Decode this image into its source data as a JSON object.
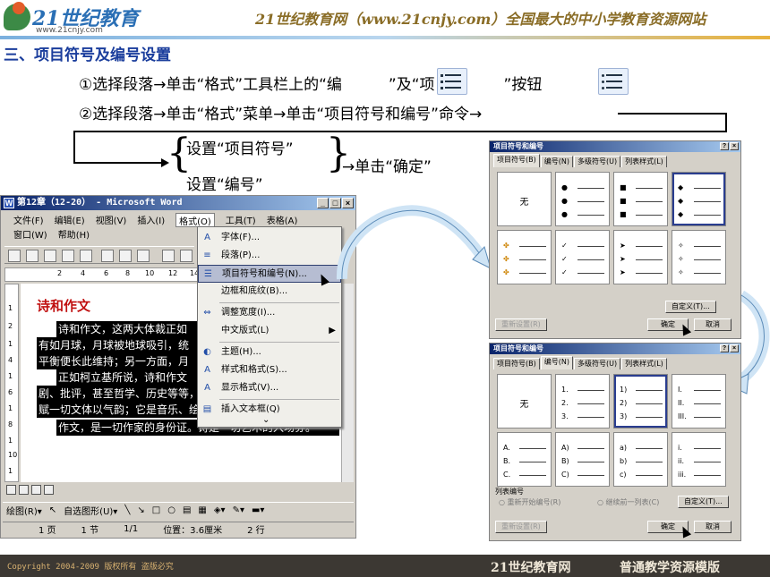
{
  "header": {
    "logo_text": "21世纪教育",
    "logo_url": "www.21cnjy.com",
    "slogan": "21世纪教育网（www.21cnjy.com）全国最大的中小学教育资源网站"
  },
  "section_title": "三、项目符号及编号设置",
  "step1": {
    "a": "①选择段落→单击“格式”工具栏上的“编",
    "b": "”及“项目",
    "c": "”按钮"
  },
  "step2": "②选择段落→单击“格式”菜单→单击“项目符号和编号”命令→",
  "options": {
    "bullet": "设置“项目符号”",
    "number": "设置“编号”",
    "confirm": "→单击“确定”"
  },
  "word": {
    "title": "第12章（12-20） - Microsoft Word",
    "menus": [
      "文件(F)",
      "编辑(E)",
      "视图(V)",
      "插入(I)",
      "格式(O)",
      "工具(T)",
      "表格(A)"
    ],
    "menus2": [
      "窗口(W)",
      "帮助(H)"
    ],
    "ruler": [
      "2",
      "4",
      "6",
      "8",
      "10",
      "12",
      "14"
    ],
    "vruler": [
      "1",
      "2",
      "1",
      "4",
      "1",
      "6",
      "1",
      "8",
      "1",
      "10",
      "1"
    ],
    "doc_title": "诗和作文",
    "doc_lines": [
      "诗和作文，这两大体裁正如",
      "有如月球，月球被地球吸引，统",
      "平衡便长此维持；另一方面，月",
      "正如柯立基所说，诗和作文",
      "剧、批评，甚至哲学、历史等等，",
      "赋一切文体以气韵；它是音乐、绘",
      "作文，是一切作家的身份证。诗是一切艺术的入场券。"
    ],
    "draw_bar": [
      "绘图(R)▾",
      "↖",
      "自选图形(U)▾",
      "╲",
      "↘",
      "□",
      "○",
      "▤",
      "▦",
      "◈▾",
      "✎▾",
      "▬▾"
    ],
    "status": [
      "1 页",
      "1 节",
      "1/1",
      "位置：3.6厘米",
      "2 行"
    ]
  },
  "format_menu": {
    "items": [
      "字体(F)...",
      "段落(P)...",
      "项目符号和编号(N)...",
      "边框和底纹(B)...",
      "调整宽度(I)...",
      "中文版式(L)",
      "主题(H)...",
      "样式和格式(S)...",
      "显示格式(V)...",
      "插入文本框(Q)"
    ],
    "more": "⌄"
  },
  "dialog1": {
    "title": "项目符号和编号",
    "tabs": [
      "项目符号(B)",
      "编号(N)",
      "多级符号(U)",
      "列表样式(L)"
    ],
    "none": "无",
    "markers": [
      [
        "●",
        "●",
        "●"
      ],
      [
        "■",
        "■",
        "■"
      ],
      [
        "◆",
        "◆",
        "◆"
      ],
      [
        "✤",
        "✤",
        "✤"
      ],
      [
        "✓",
        "✓",
        "✓"
      ],
      [
        "➤",
        "➤",
        "➤"
      ],
      [
        "✧",
        "✧",
        "✧"
      ]
    ],
    "customize": "自定义(T)...",
    "reset": "重新设置(R)",
    "ok": "确定",
    "cancel": "取消"
  },
  "dialog2": {
    "title": "项目符号和编号",
    "tabs": [
      "项目符号(B)",
      "编号(N)",
      "多级符号(U)",
      "列表样式(L)"
    ],
    "none": "无",
    "markers": [
      [
        "1.",
        "2.",
        "3."
      ],
      [
        "1)",
        "2)",
        "3)"
      ],
      [
        "I.",
        "II.",
        "III."
      ],
      [
        "A.",
        "B.",
        "C."
      ],
      [
        "A)",
        "B)",
        "C)"
      ],
      [
        "a)",
        "b)",
        "c)"
      ],
      [
        "i.",
        "ii.",
        "iii."
      ]
    ],
    "list_number": "列表编号",
    "restart": "重新开始编号(R)",
    "continue": "继续前一列表(C)",
    "customize": "自定义(T)...",
    "reset": "重新设置(R)",
    "ok": "确定",
    "cancel": "取消"
  },
  "footer": {
    "copyright": "Copyright 2004-2009 版权所有 盗版必究",
    "site": "21世纪教育网",
    "template": "普通教学资源模版"
  }
}
